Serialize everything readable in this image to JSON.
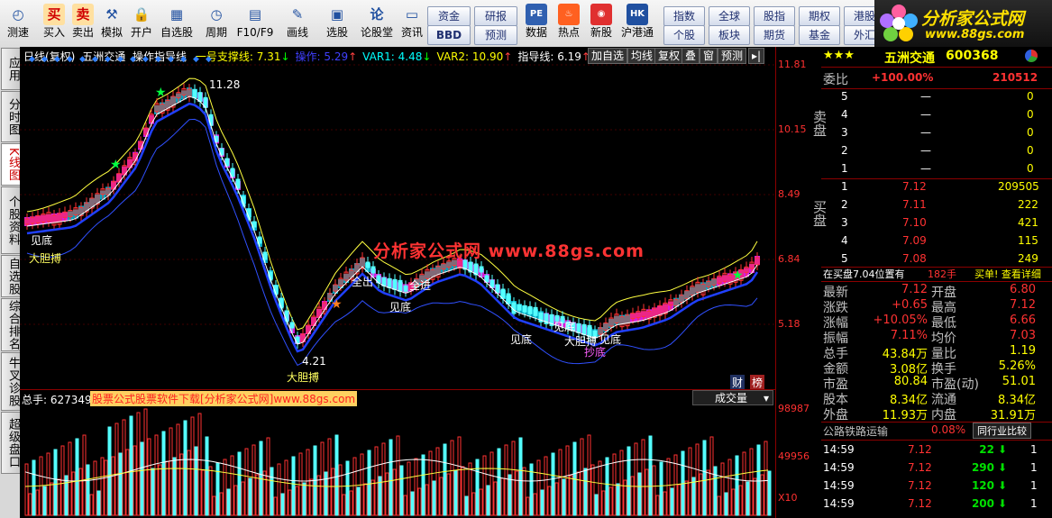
{
  "toolbar": {
    "left": [
      {
        "label": "测速",
        "icon": "◴",
        "name": "speedtest"
      },
      {
        "label": "买入",
        "icon": "买",
        "name": "buy"
      },
      {
        "label": "卖出",
        "icon": "卖",
        "name": "sell"
      },
      {
        "label": "模拟",
        "icon": "⚒",
        "name": "simulate"
      },
      {
        "label": "开户",
        "icon": "🔒",
        "name": "open-account"
      },
      {
        "label": "自选股",
        "icon": "▦",
        "name": "watchlist"
      },
      {
        "label": "周期",
        "icon": "◷",
        "name": "period"
      },
      {
        "label": "F10/F9",
        "icon": "▤",
        "name": "f10"
      },
      {
        "label": "画线",
        "icon": "✎",
        "name": "draw"
      },
      {
        "label": "选股",
        "icon": "▣",
        "name": "pick-stock"
      },
      {
        "label": "论股堂",
        "icon": "论",
        "name": "forum"
      },
      {
        "label": "资讯",
        "icon": "▭",
        "name": "news"
      }
    ],
    "mid": [
      "资金",
      "研报",
      "BBD",
      "预测"
    ],
    "tools": [
      {
        "label": "数据",
        "icon": "PE",
        "name": "data"
      },
      {
        "label": "热点",
        "icon": "♨",
        "name": "hotspot"
      },
      {
        "label": "新股",
        "icon": "◉",
        "name": "new-stock"
      },
      {
        "label": "沪港通",
        "icon": "HK",
        "name": "hk-connect"
      }
    ],
    "right_top": [
      "指数",
      "全球",
      "股指",
      "期权",
      "港股"
    ],
    "right_bottom": [
      "个股",
      "板块",
      "期货",
      "基金",
      "外汇"
    ],
    "logo_text": "分析家公式网",
    "logo_url": "www.88gs.com"
  },
  "left_tabs": [
    "应用",
    "分时图",
    "K线图",
    "个股资料",
    "自选股",
    "综合排名",
    "牛叉诊股",
    "超级盘口"
  ],
  "chart_header": {
    "period": "日线(复权)",
    "stock": "五洲交通",
    "indicator": "操作指导线",
    "items": [
      {
        "label": "一号支撑线: 7.31",
        "arrow": "↓",
        "color": "#ffff00",
        "arrow_color": "#00ff00"
      },
      {
        "label": "操作: 5.29",
        "arrow": "↑",
        "color": "#4040ff",
        "arrow_color": "#ff4040"
      },
      {
        "label": "VAR1: 4.48",
        "arrow": "↓",
        "color": "#00ffff",
        "arrow_color": "#00ff00"
      },
      {
        "label": "VAR2: 10.90",
        "arrow": "↑",
        "color": "#ffff00",
        "arrow_color": "#ff4040"
      },
      {
        "label": "指导线: 6.19",
        "arrow": "↑",
        "color": "#ffffff",
        "arrow_color": "#ff4040"
      }
    ],
    "tabs": [
      "加自选",
      "均线",
      "复权",
      "叠",
      "窗",
      "预测"
    ]
  },
  "price_axis": [
    "11.81",
    "10.15",
    "8.49",
    "6.84",
    "5.18"
  ],
  "volume_axis": [
    "98987",
    "49956",
    "X10"
  ],
  "volume_header": {
    "label": "总手: 627349",
    "ad": "股票公式股票软件下载[分析家公式网]www.88gs.com",
    "select": "成交量"
  },
  "annotations": {
    "high": "11.28",
    "low": "4.21",
    "big1": "大胆搏",
    "big2": "大胆搏",
    "jiandi": "见底",
    "jiandi2": "见底",
    "jiandi3": "见底",
    "jiandi4": "见底",
    "quanchu": "全出",
    "quanjin": "全进",
    "jiandi5": "见底",
    "chaodi": "抄底",
    "dadan": "大胆搏",
    "badge_cai": "财",
    "badge_bang": "榜"
  },
  "watermark": "分析家公式网 www.88gs.com",
  "quote": {
    "stars": "★★★",
    "name": "五洲交通",
    "code": "600368",
    "weibi_label": "委比",
    "weibi_val": "+100.00%",
    "weibi_diff": "210512",
    "sell_label": "卖盘",
    "buy_label": "买盘",
    "sell": [
      {
        "n": "5",
        "p": "—",
        "v": "0"
      },
      {
        "n": "4",
        "p": "—",
        "v": "0"
      },
      {
        "n": "3",
        "p": "—",
        "v": "0"
      },
      {
        "n": "2",
        "p": "—",
        "v": "0"
      },
      {
        "n": "1",
        "p": "—",
        "v": "0"
      }
    ],
    "buy": [
      {
        "n": "1",
        "p": "7.12",
        "v": "209505"
      },
      {
        "n": "2",
        "p": "7.11",
        "v": "222"
      },
      {
        "n": "3",
        "p": "7.10",
        "v": "421"
      },
      {
        "n": "4",
        "p": "7.09",
        "v": "115"
      },
      {
        "n": "5",
        "p": "7.08",
        "v": "249"
      }
    ],
    "buyinfo": "在买盘7.04位置有",
    "buyinfo_val": "182手",
    "buyinfo_link": "买单! 查看详细",
    "stats": [
      [
        "最新",
        "7.12",
        "开盘",
        "6.80"
      ],
      [
        "涨跌",
        "+0.65",
        "最高",
        "7.12"
      ],
      [
        "涨幅",
        "+10.05%",
        "最低",
        "6.66"
      ],
      [
        "振幅",
        "7.11%",
        "均价",
        "7.03"
      ],
      [
        "总手",
        "43.84万",
        "量比",
        "1.19"
      ],
      [
        "金额",
        "3.08亿",
        "换手",
        "5.26%"
      ],
      [
        "市盈",
        "80.84",
        "市盈(动)",
        "51.01"
      ],
      [
        "股本",
        "8.34亿",
        "流通",
        "8.34亿"
      ],
      [
        "外盘",
        "11.93万",
        "内盘",
        "31.91万"
      ]
    ],
    "industry": "公路铁路运输",
    "industry_pct": "0.08%",
    "industry_btn": "同行业比较",
    "ticks": [
      {
        "t": "14:59",
        "p": "7.12",
        "v": "22",
        "n": "1"
      },
      {
        "t": "14:59",
        "p": "7.12",
        "v": "290",
        "n": "1"
      },
      {
        "t": "14:59",
        "p": "7.12",
        "v": "120",
        "n": "1"
      },
      {
        "t": "14:59",
        "p": "7.12",
        "v": "200",
        "n": "1"
      }
    ]
  },
  "colors": {
    "up": "#ff3232",
    "down": "#54ffff",
    "ma1": "#ffffff",
    "ma2": "#ffff00",
    "band_up": "#ff20ff",
    "band_dn": "#00c0e0",
    "support": "#3050ff"
  }
}
